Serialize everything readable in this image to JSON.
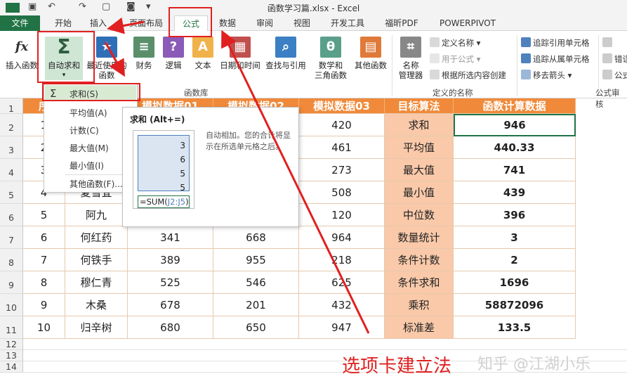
{
  "titlebar": {
    "title": "函数学习篇.xlsx - Excel"
  },
  "tabs": {
    "file": "文件",
    "home": "开始",
    "insert": "插入",
    "layout": "页面布局",
    "formula": "公式",
    "data": "数据",
    "review": "审阅",
    "view": "视图",
    "dev": "开发工具",
    "pdf": "福昕PDF",
    "powerpivot": "POWERPIVOT"
  },
  "ribbon": {
    "insert_fn": "插入函数",
    "autosum": "自动求和",
    "recent": "最近使用的",
    "recent2": "函数",
    "finance": "财务",
    "logic": "逻辑",
    "text": "文本",
    "datetime": "日期和时间",
    "lookup": "查找与引用",
    "math": "数学和",
    "math2": "三角函数",
    "other": "其他函数",
    "name_mgr": "名称",
    "name_mgr2": "管理器",
    "define_name": "定义名称",
    "use_formula": "用于公式",
    "create_sel": "根据所选内容创建",
    "trace_prec": "追踪引用单元格",
    "trace_dep": "追踪从属单元格",
    "remove_arrows": "移去箭头",
    "err_check": "错误",
    "show_formula": "公式",
    "grp_fnlib": "函数库",
    "grp_names": "定义的名称",
    "grp_audit": "公式审核"
  },
  "dropdown": {
    "sum": "求和(S)",
    "avg": "平均值(A)",
    "count": "计数(C)",
    "max": "最大值(M)",
    "min": "最小值(I)",
    "more": "其他函数(F)..."
  },
  "tooltip": {
    "title": "求和 (Alt+=)",
    "desc": "自动相加。您的合计将显示在所选单元格之后。",
    "vals": [
      "3",
      "6",
      "5",
      "5"
    ],
    "formula": "=SUM(",
    "range": "J2:J5",
    ")": ")"
  },
  "header_row": [
    "序",
    "姓名",
    "模拟数据01",
    "模拟数据02",
    "模拟数据03",
    "目标算法",
    "函数计算数据"
  ],
  "rows": [
    {
      "n": "1",
      "name": "",
      "a": "",
      "b": "",
      "c": "420",
      "op": "求和",
      "r": "946"
    },
    {
      "n": "2",
      "name": "",
      "a": "",
      "b": "",
      "c": "461",
      "op": "平均值",
      "r": "440.33"
    },
    {
      "n": "3",
      "name": "",
      "a": "",
      "b": "",
      "c": "273",
      "op": "最大值",
      "r": "741"
    },
    {
      "n": "4",
      "name": "夏雪宜",
      "a": "",
      "b": "",
      "c": "508",
      "op": "最小值",
      "r": "439"
    },
    {
      "n": "5",
      "name": "阿九",
      "a": "",
      "b": "",
      "c": "120",
      "op": "中位数",
      "r": "396"
    },
    {
      "n": "6",
      "name": "何红药",
      "a": "341",
      "b": "668",
      "c": "964",
      "op": "数量统计",
      "r": "3"
    },
    {
      "n": "7",
      "name": "何铁手",
      "a": "389",
      "b": "955",
      "c": "218",
      "op": "条件计数",
      "r": "2"
    },
    {
      "n": "8",
      "name": "穆仁青",
      "a": "525",
      "b": "546",
      "c": "625",
      "op": "条件求和",
      "r": "1696"
    },
    {
      "n": "9",
      "name": "木桑",
      "a": "678",
      "b": "201",
      "c": "432",
      "op": "乘积",
      "r": "58872096"
    },
    {
      "n": "10",
      "name": "归辛树",
      "a": "680",
      "b": "650",
      "c": "947",
      "op": "标准差",
      "r": "133.5"
    }
  ],
  "row_numbers": [
    "1",
    "2",
    "3",
    "4",
    "5",
    "6",
    "7",
    "8",
    "9",
    "10",
    "11",
    "12",
    "13",
    "14"
  ],
  "caption": "选项卡建立法",
  "watermark": "知乎 @江湖小乐"
}
